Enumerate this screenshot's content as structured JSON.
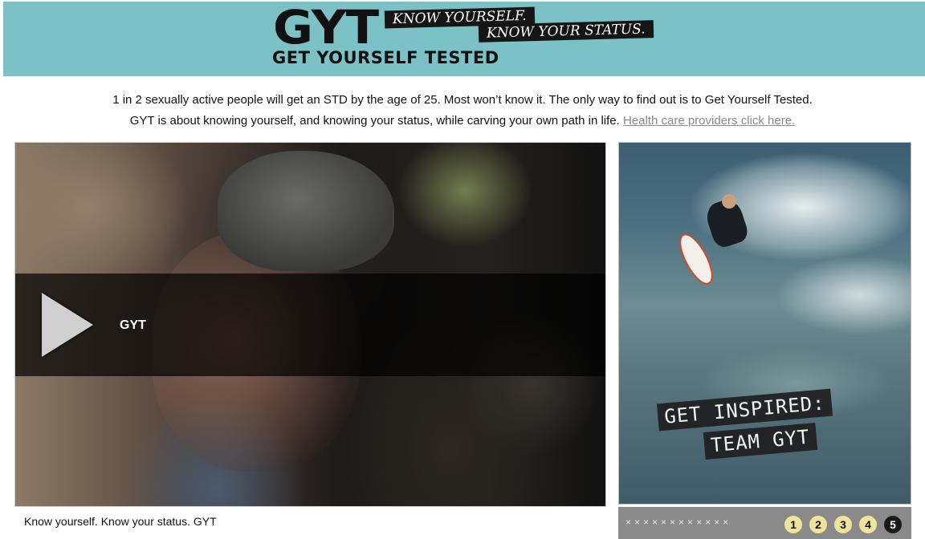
{
  "header": {
    "logo": "GYT",
    "subtitle": "GET YOURSELF TESTED",
    "tag1": "KNOW YOURSELF.",
    "tag2": "KNOW YOUR STATUS.",
    "background_color": "#7bc1c6"
  },
  "intro": {
    "line1": "1 in 2 sexually active people will get an STD by the age of 25. Most won’t know it. The only way to find out is to Get Yourself Tested.",
    "line2": "GYT is about knowing yourself, and knowing your status, while carving your own path in life.",
    "link": "Health care providers click here."
  },
  "video": {
    "title": "GYT",
    "play_icon": "play-icon",
    "caption": "Know yourself. Know your status. GYT"
  },
  "inspire": {
    "label1": "GET INSPIRED:",
    "label2": "TEAM GYT"
  },
  "pager": {
    "dots": "××××××××××××",
    "pages": [
      "1",
      "2",
      "3",
      "4",
      "5"
    ],
    "active_page": "5",
    "page_color": "#f0e39a",
    "active_color": "#1a1a1a"
  }
}
